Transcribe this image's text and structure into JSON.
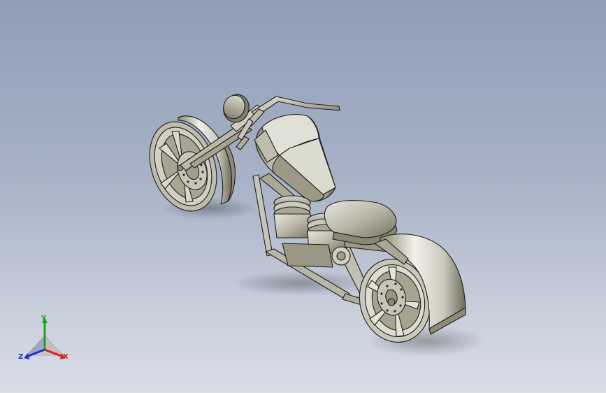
{
  "viewport": {
    "background_top": "#8f9db8",
    "background_bottom": "#d9dde6",
    "model_fill": "#c4c2b4",
    "model_stroke": "#1e1e1a"
  },
  "triad": {
    "x_label": "X",
    "y_label": "Y",
    "z_label": "Z",
    "x_color": "#d42020",
    "y_color": "#20a020",
    "z_color": "#2030d0"
  }
}
